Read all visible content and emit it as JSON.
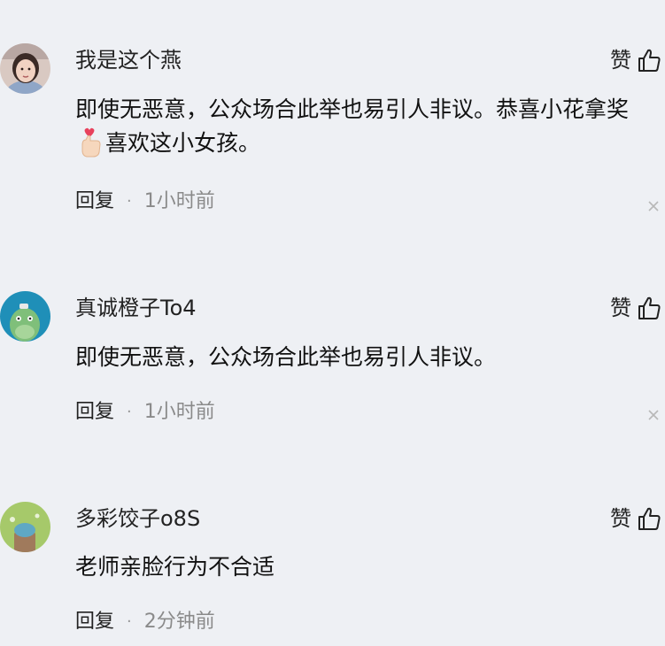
{
  "comments": [
    {
      "username": "我是这个燕",
      "like_label": "赞",
      "text_part1": "即使无恶意，公众场合此举也易引人非议。恭喜小花拿奖",
      "text_part2": "喜欢这小女孩。",
      "emoji": "finger-heart-emoji",
      "reply_label": "回复",
      "separator": "·",
      "time": "1小时前"
    },
    {
      "username": "真诚橙子To4",
      "like_label": "赞",
      "text_part1": "即使无恶意，公众场合此举也易引人非议。",
      "reply_label": "回复",
      "separator": "·",
      "time": "1小时前"
    },
    {
      "username": "多彩饺子o8S",
      "like_label": "赞",
      "text_part1": "老师亲脸行为不合适",
      "reply_label": "回复",
      "separator": "·",
      "time": "2分钟前"
    }
  ],
  "icons": {
    "like": "thumbs-up-icon",
    "dismiss": "close-icon"
  },
  "colors": {
    "background": "#eef0f4",
    "primary_text": "#1d1d1f",
    "secondary_text": "#8a8a8a"
  }
}
